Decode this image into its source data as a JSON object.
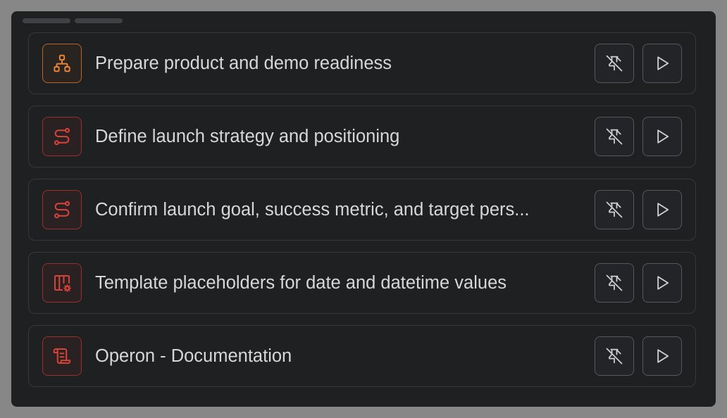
{
  "colors": {
    "orange_accent": "#e8823a",
    "red_accent": "#d9423a",
    "text": "#d6d7d9",
    "panel_bg": "#1f2022"
  },
  "items": [
    {
      "title": "Prepare product and demo readiness",
      "icon": "sitemap-icon",
      "color": "orange"
    },
    {
      "title": "Define launch strategy and positioning",
      "icon": "route-icon",
      "color": "red"
    },
    {
      "title": "Confirm launch goal, success metric, and target pers...",
      "icon": "route-icon",
      "color": "red"
    },
    {
      "title": "Template placeholders for date and datetime values",
      "icon": "template-settings-icon",
      "color": "red"
    },
    {
      "title": "Operon - Documentation",
      "icon": "scroll-icon",
      "color": "red"
    }
  ],
  "actions": {
    "unpin_icon": "pin-off-icon",
    "run_icon": "play-icon"
  }
}
